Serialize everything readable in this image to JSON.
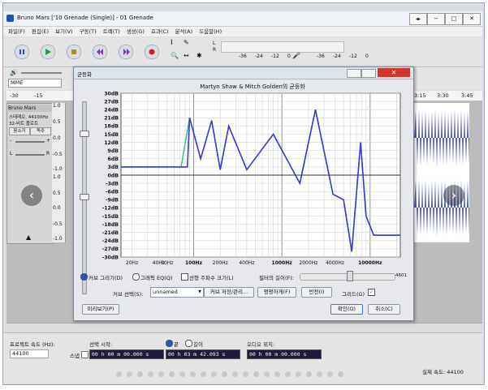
{
  "window": {
    "title": "Bruno Mars ['10 Grenade (Single)] - 01 Grenade",
    "controls": [
      "◂▸",
      "−",
      "□",
      "✕"
    ]
  },
  "menu": {
    "items": [
      "파일(F)",
      "편집(E)",
      "보기(V)",
      "구동(T)",
      "트랙(T)",
      "생성(G)",
      "효과(C)",
      "분석(A)",
      "도움말(H)"
    ]
  },
  "toolbar": {
    "transport": [
      "pause-icon",
      "play-icon",
      "stop-icon",
      "skip-start-icon",
      "skip-end-icon",
      "record-icon"
    ],
    "tools": [
      "I",
      "✎",
      "🔍",
      "↔",
      "✱"
    ],
    "meter_l_label": "L",
    "meter_r_label": "R",
    "meter_ticks": [
      "-36",
      "-24",
      "-12",
      "0"
    ]
  },
  "device": {
    "host": "MME",
    "volume_icon": "speaker-icon"
  },
  "ruler": {
    "ticks": [
      "-30",
      "-15",
      "3:15",
      "3:30",
      "3:45"
    ]
  },
  "track": {
    "name": "Bruno Mars",
    "info1": "스테레오, 44100Hz",
    "info2": "32-비트 플로트",
    "mute": "음소거",
    "solo": "독주",
    "gain_minus": "-",
    "gain_plus": "+",
    "pan_l": "L",
    "pan_r": "R",
    "scale": [
      "1.0",
      "0.5",
      "0.0",
      "-0.5",
      "-1.0",
      "1.0",
      "0.5",
      "0.0",
      "-0.5",
      "-1.0"
    ]
  },
  "dialog": {
    "title": "균등화",
    "chart_title": "Martyn Shaw & Mitch Golden의 균등화",
    "radio_curve": "커브 그리기(D)",
    "radio_graphic": "그래픽 EQ(Q)",
    "check_linear": "선형 주파수 크기(L)",
    "filter_len_label": "필터의 길이(F):",
    "filter_len_value": "4601",
    "curve_select_label": "커브 선택(S):",
    "curve_select_value": "unnamed",
    "save_button": "커브 저장/관리...",
    "flatten_button": "평평하게(F)",
    "invert_button": "반전(I)",
    "grid_label": "그리드(G)",
    "preview_button": "미리보기(P)",
    "ok_button": "확인(O)",
    "cancel_button": "취소(C)"
  },
  "status": {
    "rate_label": "프로젝트 속도 (Hz):",
    "rate_value": "44100",
    "snap_label": "스냅",
    "sel_start_label": "선택 시작:",
    "end_radio": "끝",
    "length_radio": "길이",
    "audio_pos_label": "오디오 위치:",
    "time1": "00 h 00 m 00.000 s",
    "time2": "00 h 03 m 42.093 s",
    "time3": "00 h 00 m 00.000 s",
    "actual_rate": "실제 속도: 44100"
  },
  "chart_data": {
    "type": "line",
    "title": "Martyn Shaw & Mitch Golden의 균등화",
    "ylim": [
      -30,
      30
    ],
    "yticks": [
      "30dB",
      "27dB",
      "24dB",
      "21dB",
      "18dB",
      "15dB",
      "12dB",
      "9dB",
      "6dB",
      "3dB",
      "0dB",
      "-3dB",
      "-6dB",
      "-9dB",
      "-12dB",
      "-15dB",
      "-18dB",
      "-21dB",
      "-24dB",
      "-27dB",
      "-30dB"
    ],
    "xticks": [
      {
        "label": "20Hz",
        "hz": 20
      },
      {
        "label": "40Hz",
        "hz": 40
      },
      {
        "label": "50Hz",
        "hz": 50
      },
      {
        "label": "100Hz",
        "hz": 100
      },
      {
        "label": "200Hz",
        "hz": 200
      },
      {
        "label": "400Hz",
        "hz": 400
      },
      {
        "label": "1000Hz",
        "hz": 1000
      },
      {
        "label": "2000Hz",
        "hz": 2000
      },
      {
        "label": "4000Hz",
        "hz": 4000
      },
      {
        "label": "10000Hz",
        "hz": 10000
      }
    ],
    "xlim_hz": [
      15,
      22000
    ],
    "grid": true,
    "series": [
      {
        "color": "#3a3ad0",
        "points": [
          [
            15,
            3
          ],
          [
            85,
            3
          ],
          [
            90,
            21
          ],
          [
            120,
            6
          ],
          [
            160,
            20
          ],
          [
            200,
            2
          ],
          [
            250,
            18
          ],
          [
            400,
            2
          ],
          [
            800,
            15
          ],
          [
            1600,
            -3
          ],
          [
            2400,
            24
          ],
          [
            3800,
            -7
          ],
          [
            5000,
            -9
          ],
          [
            6200,
            -28
          ],
          [
            7800,
            12
          ],
          [
            9000,
            -15
          ],
          [
            11000,
            -22
          ],
          [
            22000,
            -22
          ]
        ]
      },
      {
        "color": "#22c48a",
        "points": [
          [
            15,
            3
          ],
          [
            72,
            3
          ],
          [
            90,
            21
          ],
          [
            120,
            6
          ],
          [
            160,
            20
          ],
          [
            200,
            2
          ],
          [
            250,
            18
          ],
          [
            400,
            2
          ],
          [
            800,
            15
          ],
          [
            1600,
            -3
          ],
          [
            2400,
            24
          ],
          [
            3800,
            -7
          ],
          [
            5000,
            -9
          ],
          [
            6200,
            -28
          ],
          [
            7800,
            12
          ],
          [
            9000,
            -15
          ],
          [
            11000,
            -22
          ],
          [
            22000,
            -22
          ]
        ]
      }
    ]
  },
  "nav": {
    "prev": "‹",
    "next": "›"
  }
}
